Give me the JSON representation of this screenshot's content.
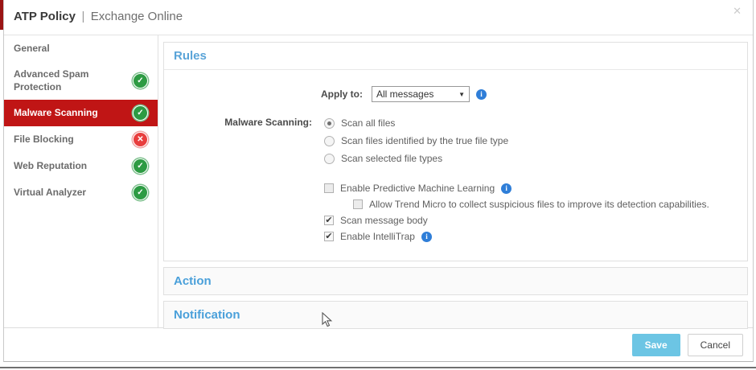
{
  "dialog": {
    "title": "ATP Policy",
    "separator": "|",
    "subtitle": "Exchange Online",
    "close_glyph": "✕"
  },
  "sidebar": {
    "items": [
      {
        "label": "General",
        "status": "none",
        "selected": false
      },
      {
        "label": "Advanced Spam Protection",
        "status": "ok",
        "selected": false
      },
      {
        "label": "Malware Scanning",
        "status": "ok",
        "selected": true
      },
      {
        "label": "File Blocking",
        "status": "error",
        "selected": false
      },
      {
        "label": "Web Reputation",
        "status": "ok",
        "selected": false
      },
      {
        "label": "Virtual Analyzer",
        "status": "ok",
        "selected": false
      }
    ],
    "status_glyphs": {
      "ok": "✓",
      "error": "✕"
    }
  },
  "rules": {
    "header": "Rules",
    "apply_to_label": "Apply to:",
    "apply_to_value": "All messages",
    "select_arrow": "▼",
    "malware_scanning_label": "Malware Scanning:",
    "radio_options": [
      {
        "label": "Scan all files",
        "selected": true
      },
      {
        "label": "Scan files identified by the true file type",
        "selected": false
      },
      {
        "label": "Scan selected file types",
        "selected": false
      }
    ],
    "checkboxes": [
      {
        "label": "Enable Predictive Machine Learning",
        "checked": false,
        "info": true,
        "indent": false
      },
      {
        "label": "Allow Trend Micro to collect suspicious files to improve its detection capabilities.",
        "checked": false,
        "info": false,
        "indent": true
      },
      {
        "label": "Scan message body",
        "checked": true,
        "info": false,
        "indent": false
      },
      {
        "label": "Enable IntelliTrap",
        "checked": true,
        "info": true,
        "indent": false
      }
    ],
    "info_glyph": "i"
  },
  "sections": {
    "action": "Action",
    "notification": "Notification"
  },
  "footer": {
    "save": "Save",
    "cancel": "Cancel"
  },
  "colors": {
    "selected_red": "#c01515",
    "page_strip_red": "#9a1414",
    "section_blue": "#5aa4d8",
    "save_blue": "#6cc5e4",
    "ok_green": "#2d9b43",
    "error_red": "#e83e3e",
    "info_blue": "#2f7ed8"
  }
}
